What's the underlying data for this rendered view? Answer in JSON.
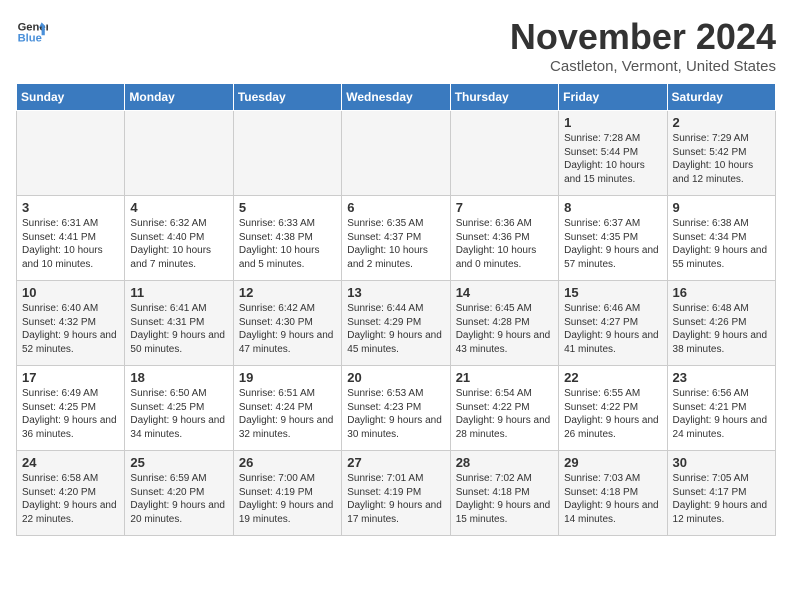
{
  "logo": {
    "line1": "General",
    "line2": "Blue"
  },
  "title": "November 2024",
  "location": "Castleton, Vermont, United States",
  "headers": [
    "Sunday",
    "Monday",
    "Tuesday",
    "Wednesday",
    "Thursday",
    "Friday",
    "Saturday"
  ],
  "weeks": [
    [
      {
        "day": "",
        "content": ""
      },
      {
        "day": "",
        "content": ""
      },
      {
        "day": "",
        "content": ""
      },
      {
        "day": "",
        "content": ""
      },
      {
        "day": "",
        "content": ""
      },
      {
        "day": "1",
        "content": "Sunrise: 7:28 AM\nSunset: 5:44 PM\nDaylight: 10 hours and 15 minutes."
      },
      {
        "day": "2",
        "content": "Sunrise: 7:29 AM\nSunset: 5:42 PM\nDaylight: 10 hours and 12 minutes."
      }
    ],
    [
      {
        "day": "3",
        "content": "Sunrise: 6:31 AM\nSunset: 4:41 PM\nDaylight: 10 hours and 10 minutes."
      },
      {
        "day": "4",
        "content": "Sunrise: 6:32 AM\nSunset: 4:40 PM\nDaylight: 10 hours and 7 minutes."
      },
      {
        "day": "5",
        "content": "Sunrise: 6:33 AM\nSunset: 4:38 PM\nDaylight: 10 hours and 5 minutes."
      },
      {
        "day": "6",
        "content": "Sunrise: 6:35 AM\nSunset: 4:37 PM\nDaylight: 10 hours and 2 minutes."
      },
      {
        "day": "7",
        "content": "Sunrise: 6:36 AM\nSunset: 4:36 PM\nDaylight: 10 hours and 0 minutes."
      },
      {
        "day": "8",
        "content": "Sunrise: 6:37 AM\nSunset: 4:35 PM\nDaylight: 9 hours and 57 minutes."
      },
      {
        "day": "9",
        "content": "Sunrise: 6:38 AM\nSunset: 4:34 PM\nDaylight: 9 hours and 55 minutes."
      }
    ],
    [
      {
        "day": "10",
        "content": "Sunrise: 6:40 AM\nSunset: 4:32 PM\nDaylight: 9 hours and 52 minutes."
      },
      {
        "day": "11",
        "content": "Sunrise: 6:41 AM\nSunset: 4:31 PM\nDaylight: 9 hours and 50 minutes."
      },
      {
        "day": "12",
        "content": "Sunrise: 6:42 AM\nSunset: 4:30 PM\nDaylight: 9 hours and 47 minutes."
      },
      {
        "day": "13",
        "content": "Sunrise: 6:44 AM\nSunset: 4:29 PM\nDaylight: 9 hours and 45 minutes."
      },
      {
        "day": "14",
        "content": "Sunrise: 6:45 AM\nSunset: 4:28 PM\nDaylight: 9 hours and 43 minutes."
      },
      {
        "day": "15",
        "content": "Sunrise: 6:46 AM\nSunset: 4:27 PM\nDaylight: 9 hours and 41 minutes."
      },
      {
        "day": "16",
        "content": "Sunrise: 6:48 AM\nSunset: 4:26 PM\nDaylight: 9 hours and 38 minutes."
      }
    ],
    [
      {
        "day": "17",
        "content": "Sunrise: 6:49 AM\nSunset: 4:25 PM\nDaylight: 9 hours and 36 minutes."
      },
      {
        "day": "18",
        "content": "Sunrise: 6:50 AM\nSunset: 4:25 PM\nDaylight: 9 hours and 34 minutes."
      },
      {
        "day": "19",
        "content": "Sunrise: 6:51 AM\nSunset: 4:24 PM\nDaylight: 9 hours and 32 minutes."
      },
      {
        "day": "20",
        "content": "Sunrise: 6:53 AM\nSunset: 4:23 PM\nDaylight: 9 hours and 30 minutes."
      },
      {
        "day": "21",
        "content": "Sunrise: 6:54 AM\nSunset: 4:22 PM\nDaylight: 9 hours and 28 minutes."
      },
      {
        "day": "22",
        "content": "Sunrise: 6:55 AM\nSunset: 4:22 PM\nDaylight: 9 hours and 26 minutes."
      },
      {
        "day": "23",
        "content": "Sunrise: 6:56 AM\nSunset: 4:21 PM\nDaylight: 9 hours and 24 minutes."
      }
    ],
    [
      {
        "day": "24",
        "content": "Sunrise: 6:58 AM\nSunset: 4:20 PM\nDaylight: 9 hours and 22 minutes."
      },
      {
        "day": "25",
        "content": "Sunrise: 6:59 AM\nSunset: 4:20 PM\nDaylight: 9 hours and 20 minutes."
      },
      {
        "day": "26",
        "content": "Sunrise: 7:00 AM\nSunset: 4:19 PM\nDaylight: 9 hours and 19 minutes."
      },
      {
        "day": "27",
        "content": "Sunrise: 7:01 AM\nSunset: 4:19 PM\nDaylight: 9 hours and 17 minutes."
      },
      {
        "day": "28",
        "content": "Sunrise: 7:02 AM\nSunset: 4:18 PM\nDaylight: 9 hours and 15 minutes."
      },
      {
        "day": "29",
        "content": "Sunrise: 7:03 AM\nSunset: 4:18 PM\nDaylight: 9 hours and 14 minutes."
      },
      {
        "day": "30",
        "content": "Sunrise: 7:05 AM\nSunset: 4:17 PM\nDaylight: 9 hours and 12 minutes."
      }
    ]
  ]
}
